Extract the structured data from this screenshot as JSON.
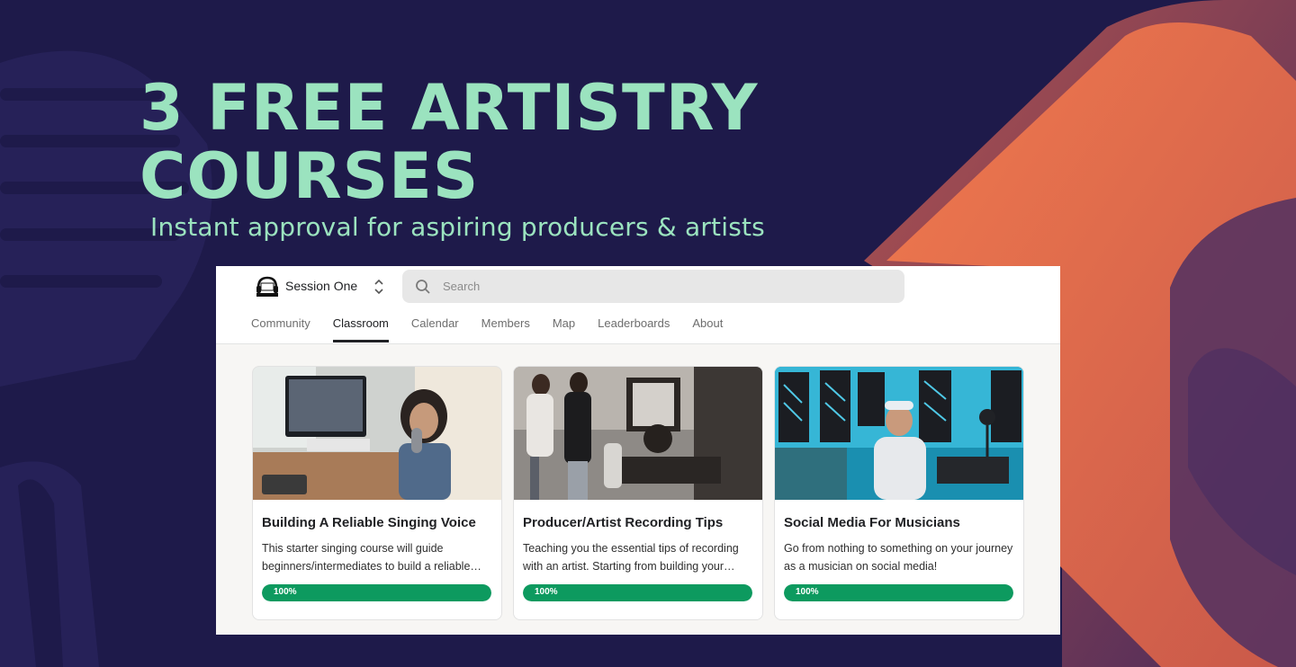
{
  "hero": {
    "title_line1": "3 FREE ARTISTRY",
    "title_line2": "COURSES",
    "subtitle": "Instant approval for aspiring producers & artists"
  },
  "colors": {
    "background": "#1e1a4a",
    "accent_text": "#9be3bf",
    "progress": "#0d9a5f",
    "orange_band": "#e9714c"
  },
  "app": {
    "group_name": "Session One",
    "logo_text": "SESSION ONE",
    "search": {
      "placeholder": "Search",
      "value": ""
    },
    "tabs": [
      {
        "label": "Community",
        "active": false
      },
      {
        "label": "Classroom",
        "active": true
      },
      {
        "label": "Calendar",
        "active": false
      },
      {
        "label": "Members",
        "active": false
      },
      {
        "label": "Map",
        "active": false
      },
      {
        "label": "Leaderboards",
        "active": false
      },
      {
        "label": "About",
        "active": false
      }
    ],
    "courses": [
      {
        "title": "Building A Reliable Singing Voice",
        "description": "This starter singing course will guide beginners/intermediates to build a reliable…",
        "progress_label": "100%",
        "progress": 1.0,
        "image": "singer-in-home-studio-photo"
      },
      {
        "title": "Producer/Artist Recording Tips",
        "description": "Teaching you the essential tips of recording with an artist. Starting from building your…",
        "progress_label": "100%",
        "progress": 1.0,
        "image": "group-in-recording-studio-photo"
      },
      {
        "title": "Social Media For Musicians",
        "description": "Go from nothing to something on your journey as a musician on social media!",
        "progress_label": "100%",
        "progress": 1.0,
        "image": "creator-at-desk-photo"
      }
    ]
  }
}
